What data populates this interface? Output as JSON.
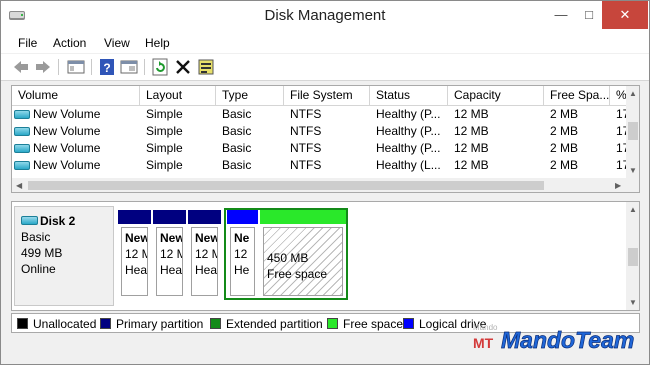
{
  "window": {
    "title": "Disk Management"
  },
  "menu": [
    "File",
    "Action",
    "View",
    "Help"
  ],
  "toolbar": [
    "back-icon",
    "forward-icon",
    "console-tree-icon",
    "help-icon",
    "properties-icon",
    "refresh-icon",
    "delete-icon",
    "rescan-icon"
  ],
  "volumes": {
    "columns": [
      "Volume",
      "Layout",
      "Type",
      "File System",
      "Status",
      "Capacity",
      "Free Spa...",
      "%"
    ],
    "rows": [
      [
        "New Volume",
        "Simple",
        "Basic",
        "NTFS",
        "Healthy (P...",
        "12 MB",
        "2 MB",
        "17"
      ],
      [
        "New Volume",
        "Simple",
        "Basic",
        "NTFS",
        "Healthy (P...",
        "12 MB",
        "2 MB",
        "17"
      ],
      [
        "New Volume",
        "Simple",
        "Basic",
        "NTFS",
        "Healthy (P...",
        "12 MB",
        "2 MB",
        "17"
      ],
      [
        "New Volume",
        "Simple",
        "Basic",
        "NTFS",
        "Healthy (L...",
        "12 MB",
        "2 MB",
        "17"
      ]
    ]
  },
  "disk": {
    "name": "Disk 2",
    "type": "Basic",
    "size": "499 MB",
    "status": "Online",
    "partitions": [
      {
        "title": "New",
        "size": "12 M",
        "status": "Hea",
        "color": "#000080"
      },
      {
        "title": "New",
        "size": "12 M",
        "status": "Hea",
        "color": "#000080"
      },
      {
        "title": "New",
        "size": "12 M",
        "status": "Hea",
        "color": "#000080"
      },
      {
        "title": "Ne",
        "size": "12",
        "status": "He",
        "color": "#0000ff"
      }
    ],
    "free": {
      "size": "450 MB",
      "label": "Free space",
      "color": "#2ae82a"
    }
  },
  "legend": [
    {
      "label": "Unallocated",
      "color": "#000000"
    },
    {
      "label": "Primary partition",
      "color": "#000080"
    },
    {
      "label": "Extended partition",
      "color": "#138a18"
    },
    {
      "label": "Free space",
      "color": "#2ae82a"
    },
    {
      "label": "Logical drive",
      "color": "#0000ff"
    }
  ],
  "watermark": {
    "top": "Mando",
    "main": "MandoTeam",
    "sub": "MT"
  }
}
